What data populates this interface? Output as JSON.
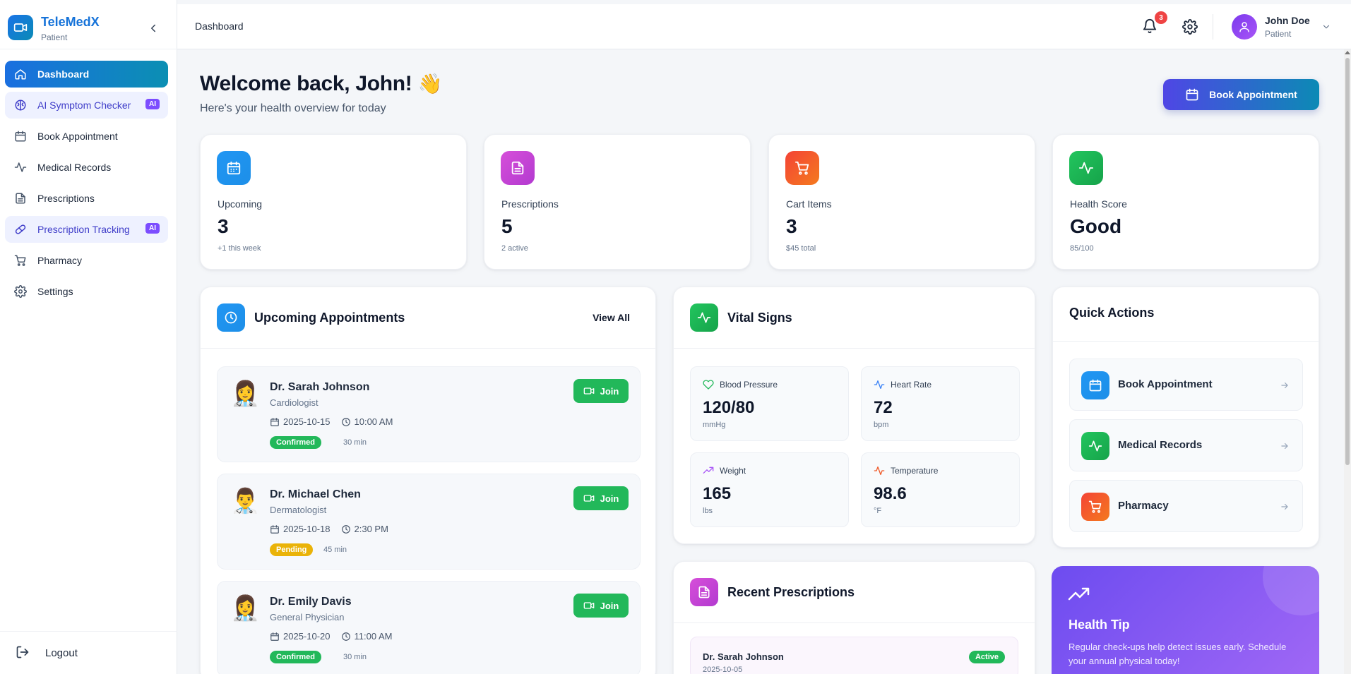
{
  "brand": {
    "name": "TeleMedX",
    "role": "Patient"
  },
  "sidebar": {
    "items": [
      {
        "label": "Dashboard",
        "icon": "home-icon",
        "state": "active"
      },
      {
        "label": "AI Symptom Checker",
        "icon": "brain-icon",
        "badge": "AI"
      },
      {
        "label": "Book Appointment",
        "icon": "calendar-icon"
      },
      {
        "label": "Medical Records",
        "icon": "activity-icon"
      },
      {
        "label": "Prescriptions",
        "icon": "file-text-icon"
      },
      {
        "label": "Prescription Tracking",
        "icon": "pill-icon",
        "badge": "AI"
      },
      {
        "label": "Pharmacy",
        "icon": "cart-icon"
      },
      {
        "label": "Settings",
        "icon": "gear-icon"
      }
    ],
    "logout": "Logout"
  },
  "topbar": {
    "breadcrumb": "Dashboard",
    "notifications": "3",
    "user": {
      "name": "John Doe",
      "role": "Patient"
    }
  },
  "main": {
    "welcome": "Welcome back, John!",
    "wave": "👋",
    "subtitle": "Here's your health overview for today",
    "book_button": "Book Appointment"
  },
  "stats": [
    {
      "label": "Upcoming",
      "value": "3",
      "sub": "+1 this week",
      "color": "#1d8fe8"
    },
    {
      "label": "Prescriptions",
      "value": "5",
      "sub": "2 active",
      "color": "#c548d6"
    },
    {
      "label": "Cart Items",
      "value": "3",
      "sub": "$45 total",
      "color": "#f0532e"
    },
    {
      "label": "Health Score",
      "value": "Good",
      "sub": "85/100",
      "color": "#1fb864"
    }
  ],
  "appointments": {
    "title": "Upcoming Appointments",
    "view_all": "View All",
    "join_label": "Join",
    "items": [
      {
        "emoji": "👩‍⚕️",
        "doctor": "Dr. Sarah Johnson",
        "specialty": "Cardiologist",
        "date": "2025-10-15",
        "time": "10:00 AM",
        "status": "Confirmed",
        "status_color": "#22b85a",
        "duration": "30 min"
      },
      {
        "emoji": "👨‍⚕️",
        "doctor": "Dr. Michael Chen",
        "specialty": "Dermatologist",
        "date": "2025-10-18",
        "time": "2:30 PM",
        "status": "Pending",
        "status_color": "#eab308",
        "duration": "45 min"
      },
      {
        "emoji": "👩‍⚕️",
        "doctor": "Dr. Emily Davis",
        "specialty": "General Physician",
        "date": "2025-10-20",
        "time": "11:00 AM",
        "status": "Confirmed",
        "status_color": "#22b85a",
        "duration": "30 min"
      }
    ]
  },
  "vitals": {
    "title": "Vital Signs",
    "items": [
      {
        "label": "Blood Pressure",
        "value": "120/80",
        "unit": "mmHg",
        "icon": "heart-icon"
      },
      {
        "label": "Heart Rate",
        "value": "72",
        "unit": "bpm",
        "icon": "pulse-icon"
      },
      {
        "label": "Weight",
        "value": "165",
        "unit": "lbs",
        "icon": "trend-up-icon"
      },
      {
        "label": "Temperature",
        "value": "98.6",
        "unit": "°F",
        "icon": "pulse-icon"
      }
    ]
  },
  "quick_actions": {
    "title": "Quick Actions",
    "items": [
      {
        "label": "Book Appointment",
        "icon": "calendar-icon"
      },
      {
        "label": "Medical Records",
        "icon": "activity-icon"
      },
      {
        "label": "Pharmacy",
        "icon": "cart-icon"
      }
    ]
  },
  "prescriptions": {
    "title": "Recent Prescriptions",
    "items": [
      {
        "doctor": "Dr. Sarah Johnson",
        "date": "2025-10-05",
        "status": "Active"
      }
    ]
  },
  "health_tip": {
    "title": "Health Tip",
    "text": "Regular check-ups help detect issues early. Schedule your annual physical today!"
  }
}
